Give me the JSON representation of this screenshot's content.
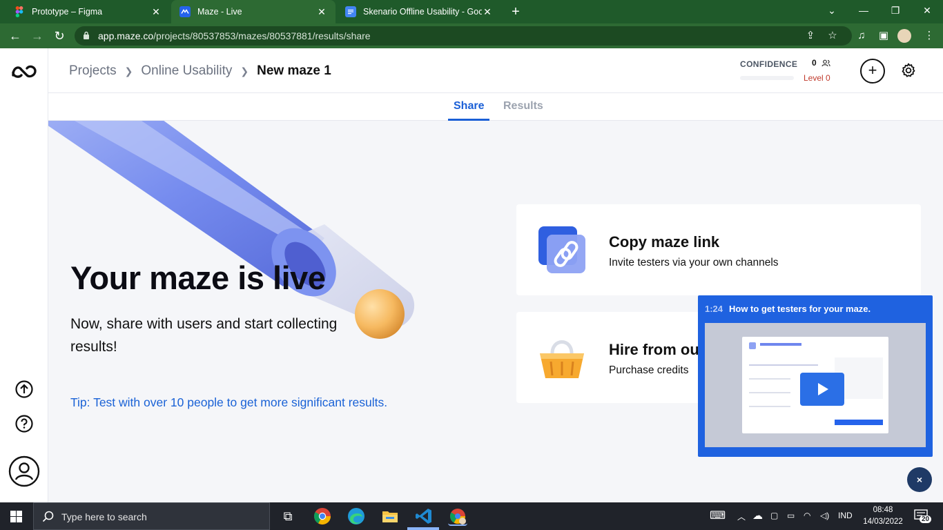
{
  "browser": {
    "tabs": [
      {
        "title": "Prototype – Figma",
        "active": false
      },
      {
        "title": "Maze - Live",
        "active": true
      },
      {
        "title": "Skenario Offline Usability - Goog",
        "active": false
      }
    ],
    "url_host": "app.maze.co",
    "url_path": "/projects/80537853/mazes/80537881/results/share"
  },
  "breadcrumbs": {
    "projects": "Projects",
    "project": "Online Usability",
    "current": "New maze 1"
  },
  "confidence": {
    "label": "CONFIDENCE",
    "count": "0",
    "level": "Level 0",
    "fraction": 0.0
  },
  "page_tabs": {
    "share": "Share",
    "results": "Results"
  },
  "hero": {
    "headline": "Your maze is live",
    "subline": "Now, share with users and start collecting results!",
    "tip": "Tip: Test with over 10 people to get more significant results."
  },
  "cards": {
    "copy_title": "Copy maze link",
    "copy_sub": "Invite testers via your own channels",
    "hire_title": "Hire from ou",
    "hire_sub": "Purchase credits"
  },
  "video": {
    "duration": "1:24",
    "title": "How to get testers for your maze.",
    "close": "×"
  },
  "taskbar": {
    "search_placeholder": "Type here to search",
    "lang": "IND",
    "time": "08:48",
    "date": "14/03/2022",
    "notifications": "20"
  },
  "colors": {
    "chrome_frame": "#1f5a2a",
    "chrome_toolbar": "#2d6a33",
    "accent": "#1a5fd6",
    "level_red": "#c0392b",
    "video_blue": "#1f62e0"
  }
}
